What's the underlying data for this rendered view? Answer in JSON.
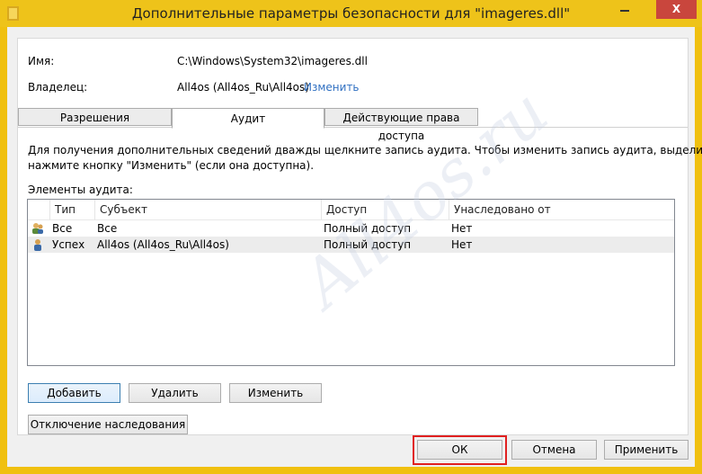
{
  "window": {
    "title": "Дополнительные параметры безопасности  для \"imageres.dll\"",
    "minimize_icon": "minimize-icon",
    "close_label": "X",
    "accent": "#eec31a",
    "close_color": "#c9463d"
  },
  "props": {
    "name_label": "Имя:",
    "name_value": "C:\\Windows\\System32\\imageres.dll",
    "owner_label": "Владелец:",
    "owner_value": "All4os (All4os_Ru\\All4os)",
    "change_link": "Изменить"
  },
  "tabs": [
    {
      "label": "Разрешения"
    },
    {
      "label": "Аудит"
    },
    {
      "label": "Действующие права доступа"
    }
  ],
  "audit": {
    "description": "Для получения дополнительных сведений дважды щелкните запись аудита. Чтобы изменить запись аудита, выделите ее и",
    "description2": "нажмите кнопку \"Изменить\" (если она доступна).",
    "list_title": "Элементы аудита:",
    "columns": [
      "Тип",
      "Субъект",
      "Доступ",
      "Унаследовано от"
    ],
    "rows": [
      {
        "icon": "users-icon",
        "type": "Все",
        "subject": "Все",
        "access": "Полный доступ",
        "inherited": "Нет"
      },
      {
        "icon": "user-icon",
        "type": "Успех",
        "subject": "All4os (All4os_Ru\\All4os)",
        "access": "Полный доступ",
        "inherited": "Нет"
      }
    ],
    "add_button": "Добавить",
    "remove_button": "Удалить",
    "edit_button": "Изменить",
    "disable_inherit_button": "Отключение наследования"
  },
  "footer": {
    "ok_button": "ОК",
    "cancel_button": "Отмена",
    "apply_button": "Применить"
  },
  "watermark": "All4os.ru"
}
